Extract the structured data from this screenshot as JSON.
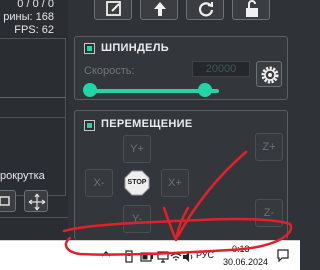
{
  "stats": {
    "coords": "0 / 0 / 0",
    "lines": "рины: 168",
    "fps": "FPS: 62"
  },
  "left": {
    "scroll_label": "рокрутка"
  },
  "spindle": {
    "title": "ШПИНДЕЛЬ",
    "speed_label": "Скорость:",
    "speed_value": "20000",
    "slider_fraction": 0.86
  },
  "move": {
    "title": "ПЕРЕМЕЩЕНИЕ",
    "y_plus": "Y+",
    "y_minus": "Y-",
    "x_plus": "X+",
    "x_minus": "X-",
    "z_plus": "Z+",
    "z_minus": "Z-",
    "stop": "STOP"
  },
  "taskbar": {
    "language": "РУС",
    "time": "0:13",
    "date": "30.06.2024"
  },
  "colors": {
    "accent": "#1ed6a6",
    "annotation": "#e3202a",
    "background": "#2f3338"
  }
}
